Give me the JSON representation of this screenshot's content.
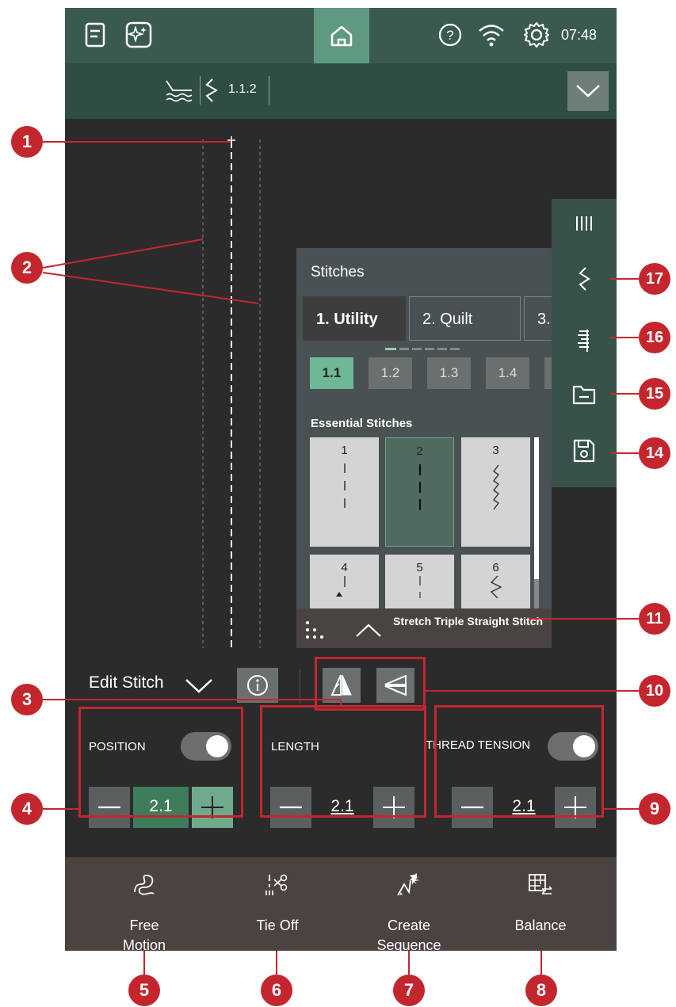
{
  "status_bar": {
    "clock": "07:48",
    "icons": [
      "manual-icon",
      "sparkle-icon",
      "home-icon",
      "help-icon",
      "wifi-icon",
      "settings-icon"
    ]
  },
  "sub_bar": {
    "stitch_number": "1.1.2",
    "icons": [
      "presser-foot-icon",
      "zigzag-icon",
      "chevron-down-icon"
    ]
  },
  "stitches_panel": {
    "title": "Stitches",
    "tabs": [
      "1. Utility",
      "2. Quilt",
      "3."
    ],
    "categories": [
      "1.1",
      "1.2",
      "1.3",
      "1.4"
    ],
    "section_title": "Essential Stitches",
    "stitch_cells": [
      "1",
      "2",
      "3",
      "4",
      "5",
      "6"
    ],
    "selected_stitch_name": "Stretch Triple Straight Stitch"
  },
  "edit": {
    "label": "Edit Stitch"
  },
  "controls": {
    "position": {
      "label": "POSITION",
      "value": "2.1",
      "toggle_on": true
    },
    "length": {
      "label": "LENGTH",
      "value": "2.1"
    },
    "thread_tension": {
      "label": "THREAD TENSION",
      "value": "2.1",
      "toggle_on": true
    }
  },
  "bottom_bar": {
    "items": [
      {
        "label_line1": "Free",
        "label_line2": "Motion"
      },
      {
        "label_line1": "Tie Off",
        "label_line2": ""
      },
      {
        "label_line1": "Create",
        "label_line2": "Sequence"
      },
      {
        "label_line1": "Balance",
        "label_line2": ""
      }
    ]
  },
  "callouts": [
    "1",
    "2",
    "3",
    "4",
    "5",
    "6",
    "7",
    "8",
    "9",
    "10",
    "11",
    "14",
    "15",
    "16",
    "17"
  ],
  "colors": {
    "accent_green": "#5f9a80",
    "selected_value": "#3f7c5c",
    "callout_red": "#c4262e",
    "topbar": "#3a5a50"
  }
}
